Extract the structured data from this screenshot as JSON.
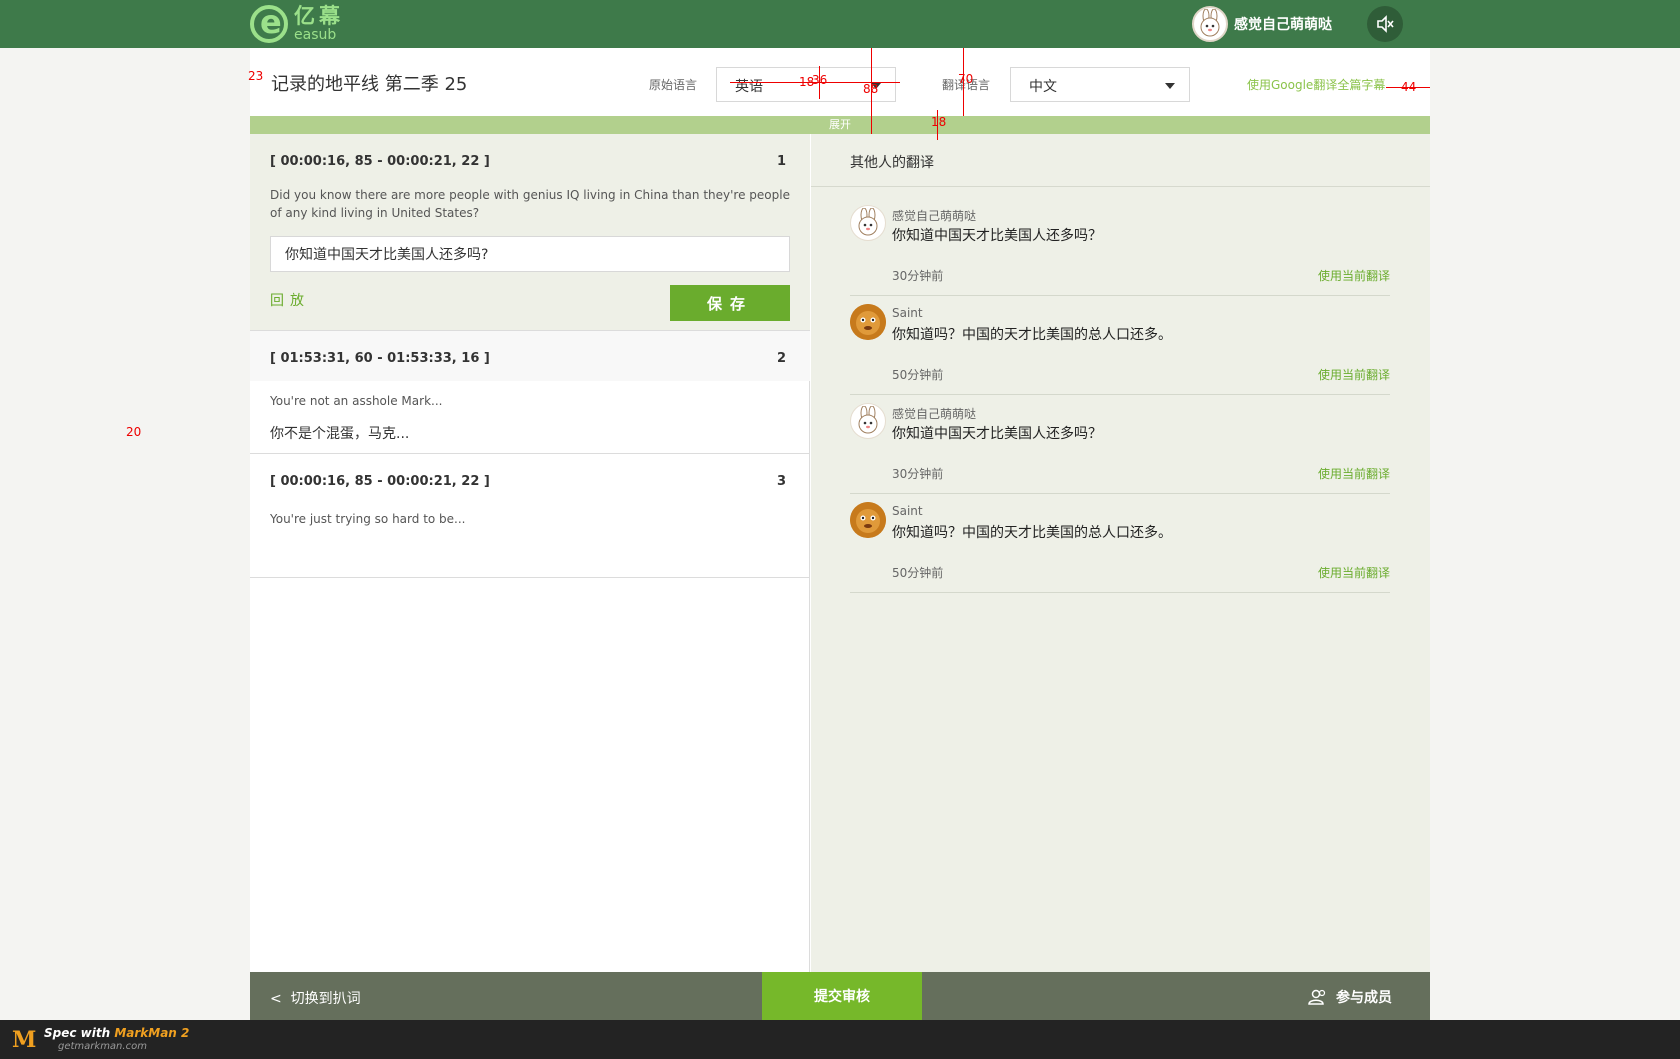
{
  "header": {
    "logo_cn": "亿幕",
    "logo_en": "easub",
    "user_name": "感觉自己萌萌哒",
    "sound_icon": "volume-mute-icon"
  },
  "toolbar": {
    "title": "记录的地平线 第二季 25",
    "source_label": "原始语言",
    "source_value": "英语",
    "target_label": "翻译语言",
    "target_value": "中文",
    "google_link": "使用Google翻译全篇字幕",
    "expand": "展开"
  },
  "segments": [
    {
      "time": "[ 00:00:16, 85 - 00:00:21, 22 ]",
      "num": "1",
      "source": "Did you know there are more people with genius IQ living in China than they're people of any kind living in United States?",
      "translation": "你知道中国天才比美国人还多吗?",
      "replay": "回放",
      "save": "保存"
    },
    {
      "time": "[ 01:53:31, 60 - 01:53:33, 16 ]",
      "num": "2",
      "source": "You're not an asshole Mark...",
      "translation": "你不是个混蛋，马克..."
    },
    {
      "time": "[ 00:00:16, 85 - 00:00:21, 22 ]",
      "num": "3",
      "source": "You're just trying so hard to be...",
      "translation": ""
    }
  ],
  "others": {
    "title": "其他人的翻译",
    "items": [
      {
        "user": "感觉自己萌萌哒",
        "text": "你知道中国天才比美国人还多吗？",
        "time": "30分钟前",
        "use": "使用当前翻译",
        "avatar": "bunny-avatar"
      },
      {
        "user": "Saint",
        "text": "你知道吗？中国的天才比美国的总人口还多。",
        "time": "50分钟前",
        "use": "使用当前翻译",
        "avatar": "face-avatar"
      },
      {
        "user": "感觉自己萌萌哒",
        "text": "你知道中国天才比美国人还多吗？",
        "time": "30分钟前",
        "use": "使用当前翻译",
        "avatar": "bunny-avatar"
      },
      {
        "user": "Saint",
        "text": "你知道吗？中国的天才比美国的总人口还多。",
        "time": "50分钟前",
        "use": "使用当前翻译",
        "avatar": "face-avatar"
      }
    ]
  },
  "bottom": {
    "switch": "切换到扒词",
    "submit": "提交审核",
    "members": "参与成员"
  },
  "footer": {
    "spec": "Spec with",
    "brand": "MarkMan 2",
    "url": "getmarkman.com"
  },
  "annotations": {
    "a23": "23",
    "a20": "20",
    "a18a": "18",
    "a36": "36",
    "a88": "88",
    "a70": "70",
    "a18b": "18",
    "a44": "44"
  },
  "colors": {
    "header": "#3e7a4a",
    "accent": "#6aac2d",
    "expand_bar": "#b2d08d",
    "right_panel": "#eef0e7",
    "bottom_bar": "#656f5c"
  }
}
